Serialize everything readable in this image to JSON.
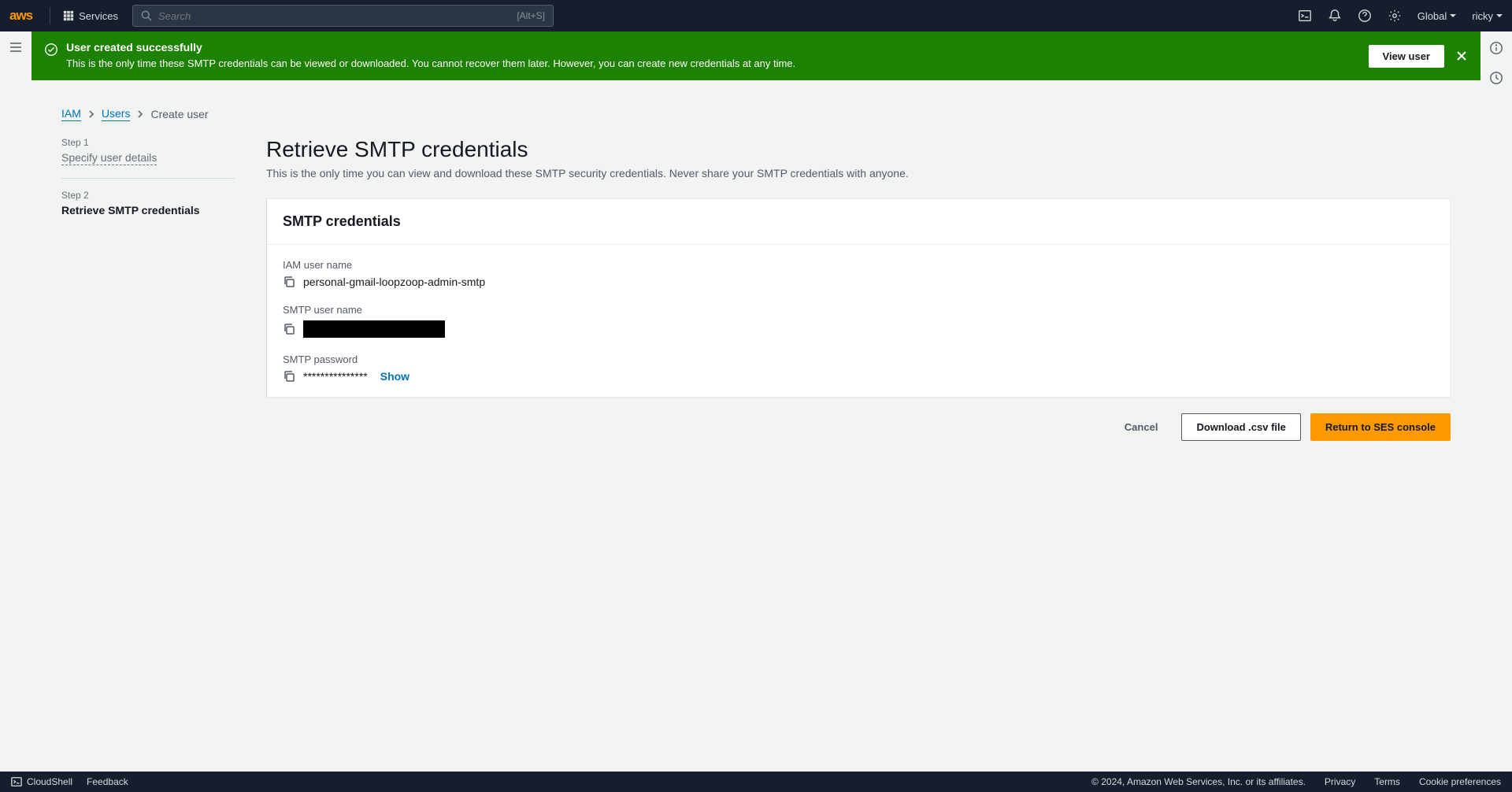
{
  "topnav": {
    "services_label": "Services",
    "search_placeholder": "Search",
    "search_hint": "[Alt+S]",
    "region": "Global",
    "user": "ricky"
  },
  "flash": {
    "title": "User created successfully",
    "description": "This is the only time these SMTP credentials can be viewed or downloaded. You cannot recover them later. However, you can create new credentials at any time.",
    "action": "View user"
  },
  "breadcrumbs": {
    "iam": "IAM",
    "users": "Users",
    "current": "Create user"
  },
  "wizard": {
    "step1_num": "Step 1",
    "step1_label": "Specify user details",
    "step2_num": "Step 2",
    "step2_label": "Retrieve SMTP credentials"
  },
  "page": {
    "title": "Retrieve SMTP credentials",
    "description": "This is the only time you can view and download these SMTP security credentials. Never share your SMTP credentials with anyone."
  },
  "panel": {
    "title": "SMTP credentials",
    "iam_label": "IAM user name",
    "iam_value": "personal-gmail-loopzoop-admin-smtp",
    "smtp_user_label": "SMTP user name",
    "smtp_pass_label": "SMTP password",
    "smtp_pass_masked": "***************",
    "show_label": "Show"
  },
  "actions": {
    "cancel": "Cancel",
    "download": "Download .csv file",
    "return": "Return to SES console"
  },
  "footer": {
    "cloudshell": "CloudShell",
    "feedback": "Feedback",
    "copyright": "© 2024, Amazon Web Services, Inc. or its affiliates.",
    "privacy": "Privacy",
    "terms": "Terms",
    "cookie": "Cookie preferences"
  }
}
